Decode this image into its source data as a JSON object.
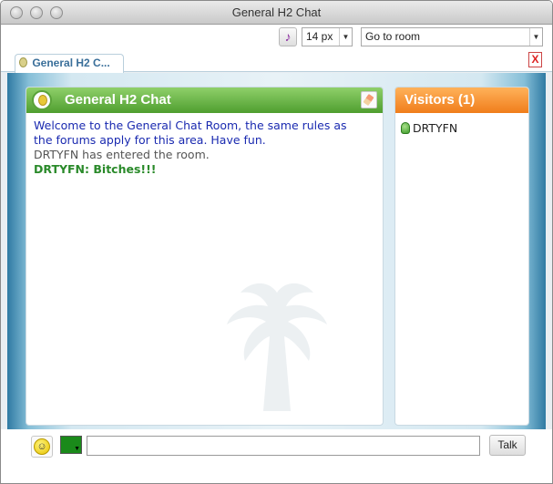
{
  "window": {
    "title": "General H2 Chat"
  },
  "toolbar": {
    "sound_icon": "music-note-icon",
    "font_size": "14 px",
    "room_select": "Go to room"
  },
  "tabs": [
    {
      "label": "General H2 C...",
      "icon": "lightbulb-icon"
    }
  ],
  "close_label": "X",
  "chat": {
    "title": "General H2 Chat",
    "header_color": "#5aa23a",
    "messages": {
      "welcome_line1": "Welcome to the General Chat Room, the same rules as",
      "welcome_line2": "the forums apply for this area.  Have fun.",
      "system": "DRTYFN has entered the room.",
      "user_name": "DRTYFN",
      "user_text": "Bitches!!!"
    }
  },
  "visitors": {
    "title": "Visitors (1)",
    "header_color": "#f07d1b",
    "items": [
      {
        "name": "DRTYFN",
        "icon": "user-online-icon"
      }
    ]
  },
  "input": {
    "emoticon_icon": "smiley-icon",
    "text_color": "#1a8a1a",
    "value": "",
    "talk_label": "Talk"
  }
}
